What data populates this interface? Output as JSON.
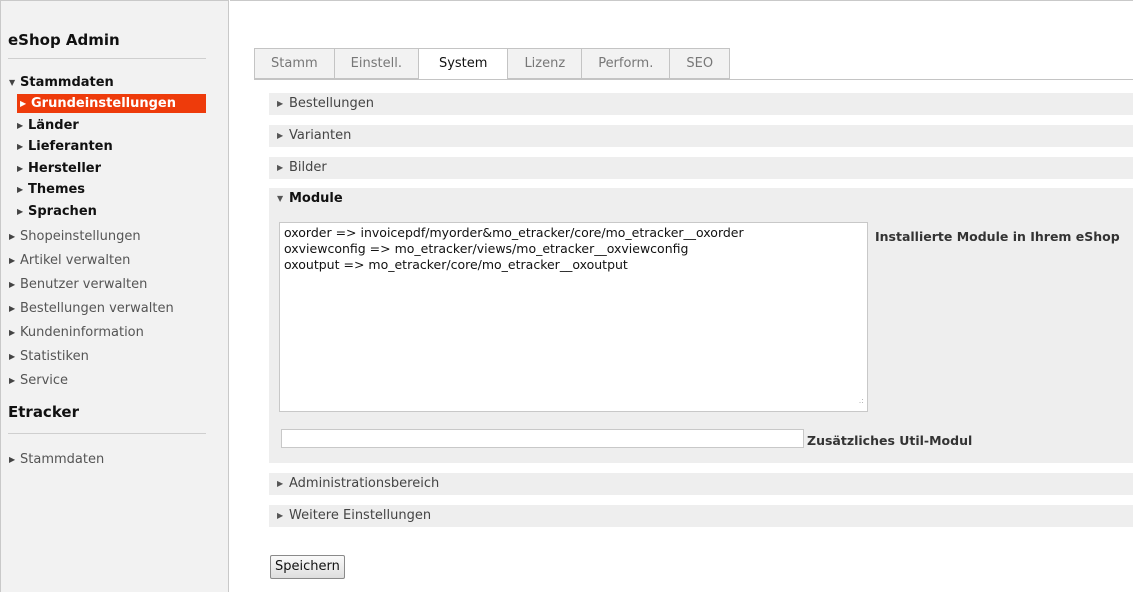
{
  "sidebar": {
    "title": "eShop Admin",
    "items": [
      {
        "label": "Stammdaten",
        "expanded": true
      },
      {
        "label": "Grundeinstellungen",
        "active": true
      },
      {
        "label": "Länder"
      },
      {
        "label": "Lieferanten"
      },
      {
        "label": "Hersteller"
      },
      {
        "label": "Themes"
      },
      {
        "label": "Sprachen"
      },
      {
        "label": "Shopeinstellungen"
      },
      {
        "label": "Artikel verwalten"
      },
      {
        "label": "Benutzer verwalten"
      },
      {
        "label": "Bestellungen verwalten"
      },
      {
        "label": "Kundeninformation"
      },
      {
        "label": "Statistiken"
      },
      {
        "label": "Service"
      }
    ],
    "section2_title": "Etracker",
    "section2_items": [
      {
        "label": "Stammdaten"
      }
    ]
  },
  "tabs": [
    {
      "label": "Stamm"
    },
    {
      "label": "Einstell."
    },
    {
      "label": "System",
      "active": true
    },
    {
      "label": "Lizenz"
    },
    {
      "label": "Perform."
    },
    {
      "label": "SEO"
    }
  ],
  "sections": [
    {
      "label": "Bestellungen"
    },
    {
      "label": "Varianten"
    },
    {
      "label": "Bilder"
    },
    {
      "label": "Module",
      "open": true
    },
    {
      "label": "Administrationsbereich"
    },
    {
      "label": "Weitere Einstellungen"
    }
  ],
  "module": {
    "textarea_value": "oxorder => invoicepdf/myorder&mo_etracker/core/mo_etracker__oxorder\noxviewconfig => mo_etracker/views/mo_etracker__oxviewconfig\noxoutput => mo_etracker/core/mo_etracker__oxoutput",
    "textarea_label": "Installierte Module in Ihrem eShop",
    "util_value": "",
    "util_label": "Zusätzliches Util-Modul"
  },
  "save_label": "Speichern",
  "colors": {
    "active_nav": "#ee3b0b",
    "panel_bg": "#eeeeee",
    "sidebar_bg": "#f2f2f2"
  }
}
